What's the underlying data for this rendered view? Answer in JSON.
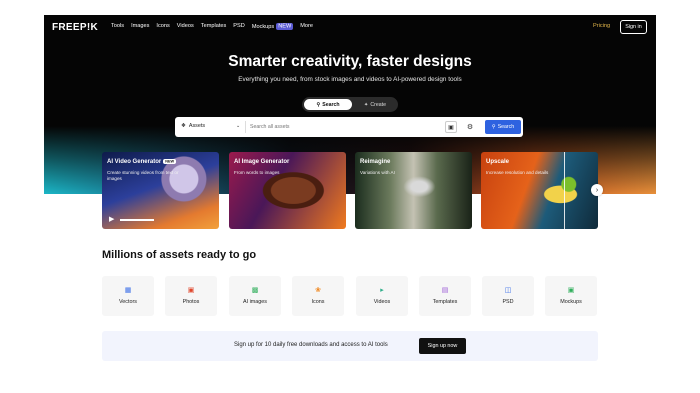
{
  "nav": {
    "logo": "FREEP!K",
    "links": [
      "Tools",
      "Images",
      "Icons",
      "Videos",
      "Templates",
      "PSD",
      "Mockups",
      "More"
    ],
    "mockups_badge": "NEW",
    "pricing": "Pricing",
    "signin": "Sign in"
  },
  "hero": {
    "title": "Smarter creativity, faster designs",
    "subtitle": "Everything you need, from stock images and videos to AI-powered design tools",
    "toggle_search": "Search",
    "toggle_create": "Create"
  },
  "search": {
    "asset_type": "Assets",
    "placeholder": "Search all assets",
    "button": "Search"
  },
  "cards": [
    {
      "title": "AI Video Generator",
      "badge": "NEW",
      "desc": "Create stunning videos from text or images"
    },
    {
      "title": "AI Image Generator",
      "desc": "From words to images"
    },
    {
      "title": "Reimagine",
      "desc": "Variations with AI"
    },
    {
      "title": "Upscale",
      "desc": "Increase resolution and details"
    }
  ],
  "assets": {
    "title": "Millions of assets ready to go",
    "categories": [
      {
        "label": "Vectors",
        "icon": "vectors-icon",
        "color": "#3a6ee8"
      },
      {
        "label": "Photos",
        "icon": "photos-icon",
        "color": "#e0452b"
      },
      {
        "label": "AI images",
        "icon": "ai-images-icon",
        "color": "#2fae5b"
      },
      {
        "label": "Icons",
        "icon": "icons-icon",
        "color": "#f08a24"
      },
      {
        "label": "Videos",
        "icon": "videos-icon",
        "color": "#2fae8a"
      },
      {
        "label": "Templates",
        "icon": "templates-icon",
        "color": "#9b5bd6"
      },
      {
        "label": "PSD",
        "icon": "psd-icon",
        "color": "#3a6ee8"
      },
      {
        "label": "Mockups",
        "icon": "mockups-icon",
        "color": "#2fae5b"
      }
    ]
  },
  "signup": {
    "text": "Sign up for 10 daily free downloads and access to AI tools",
    "button": "Sign up now"
  },
  "colors": {
    "accent": "#2e62e0",
    "pricing": "#e3b74a"
  }
}
